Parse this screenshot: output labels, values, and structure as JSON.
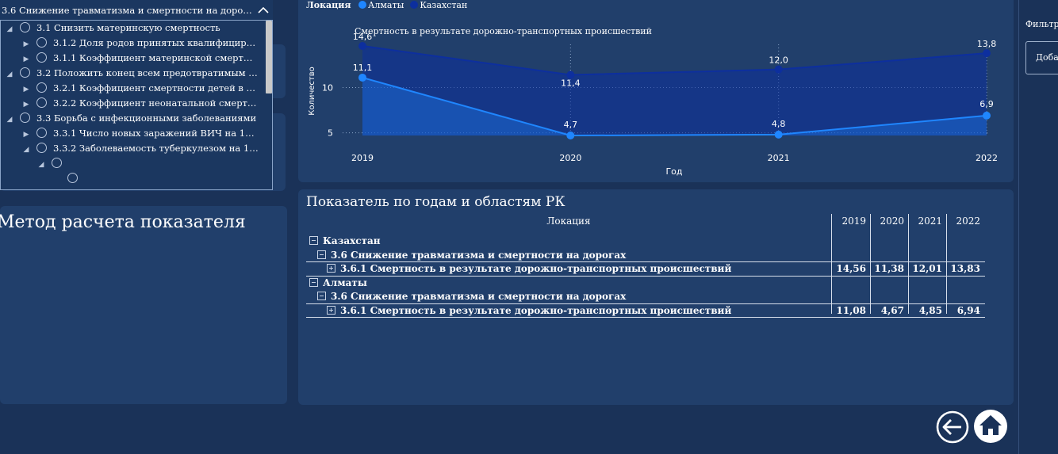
{
  "slicer": {
    "selected": "3.6 Снижение травматизма и смертности на дорог...",
    "items": [
      {
        "label": "3.1 Снизить материнскую смертность",
        "level": 0,
        "expander": "◢"
      },
      {
        "label": "3.1.2 Доля родов принятых квалифицирова...",
        "level": 1,
        "expander": "▶"
      },
      {
        "label": "3.1.1 Коэффициент материнской смертнос...",
        "level": 1,
        "expander": "▶"
      },
      {
        "label": "3.2 Положить конец всем предотвратимым сл...",
        "level": 0,
        "expander": "◢"
      },
      {
        "label": "3.2.1 Коэффициент смертности детей в воз...",
        "level": 1,
        "expander": "▶"
      },
      {
        "label": "3.2.2 Коэффициент неонатальной смертно...",
        "level": 1,
        "expander": "▶"
      },
      {
        "label": "3.3 Борьба с инфекционными заболеваниями",
        "level": 0,
        "expander": "◢"
      },
      {
        "label": "3.3.1 Число новых заражений ВИЧ на 1000 ...",
        "level": 1,
        "expander": "▶"
      },
      {
        "label": "3.3.2 Заболеваемость туберкулезом на 100 ...",
        "level": 1,
        "expander": "◢"
      },
      {
        "label": "",
        "level": 2,
        "expander": "◢"
      },
      {
        "label": "",
        "level": 3,
        "expander": ""
      }
    ]
  },
  "method": {
    "title": "Метод расчета показателя"
  },
  "legend": {
    "title": "Локация",
    "items": [
      {
        "name": "Алматы",
        "color": "#1f86ff"
      },
      {
        "name": "Казахстан",
        "color": "#0d2f9e"
      }
    ]
  },
  "chart_data": {
    "type": "area",
    "title": "Смертность в результате дорожно-транспортных происшествий",
    "xlabel": "Год",
    "ylabel": "Количество",
    "x": [
      "2019",
      "2020",
      "2021",
      "2022"
    ],
    "y_ticks": [
      "5",
      "10"
    ],
    "ylim": [
      4.7,
      14.6
    ],
    "grid": true,
    "legend_position": "top-left",
    "series": [
      {
        "name": "Казахстан",
        "values": [
          14.6,
          11.4,
          12.0,
          13.8
        ],
        "labels": [
          "14,6",
          "11,4",
          "12,0",
          "13,8"
        ],
        "color": "#0d2f9e"
      },
      {
        "name": "Алматы",
        "values": [
          11.1,
          4.7,
          4.8,
          6.9
        ],
        "labels": [
          "11,1",
          "4,7",
          "4,8",
          "6,9"
        ],
        "color": "#1f86ff"
      }
    ]
  },
  "table": {
    "title": "Показатель по годам и областям РК",
    "col_location": "Локация",
    "years": [
      "2019",
      "2020",
      "2021",
      "2022"
    ],
    "rows": [
      {
        "kind": "group",
        "label": "Казахстан",
        "values": []
      },
      {
        "kind": "sub",
        "label": "3.6 Снижение травматизма и смертности на дорогах",
        "values": []
      },
      {
        "kind": "leaf",
        "label": "3.6.1 Смертность в результате дорожно-транспортных происшествий",
        "values": [
          "14,56",
          "11,38",
          "12,01",
          "13,83"
        ]
      },
      {
        "kind": "group",
        "label": "Алматы",
        "values": []
      },
      {
        "kind": "sub",
        "label": "3.6 Снижение травматизма и смертности на дорогах",
        "values": []
      },
      {
        "kind": "leaf",
        "label": "3.6.1 Смертность в результате дорожно-транспортных происшествий",
        "values": [
          "11,08",
          "4,67",
          "4,85",
          "6,94"
        ]
      }
    ]
  },
  "filters": {
    "label": "Фильтр",
    "button": "Доба"
  },
  "nav": {
    "back_icon": "arrow-left-circle-icon",
    "home_icon": "home-icon"
  }
}
